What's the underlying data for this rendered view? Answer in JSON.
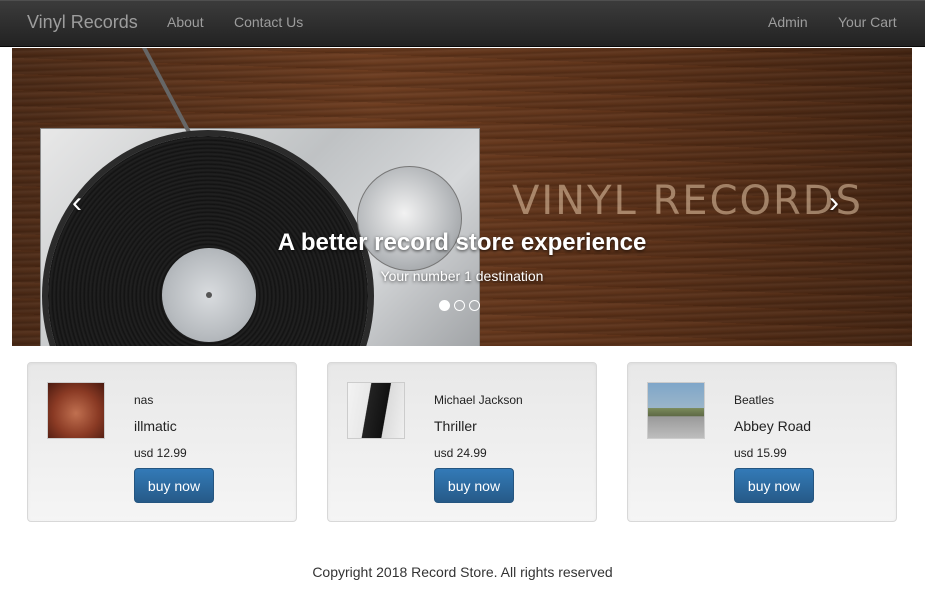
{
  "navbar": {
    "brand": "Vinyl Records",
    "links": [
      "About",
      "Contact Us"
    ],
    "right_links": [
      "Admin",
      "Your Cart"
    ]
  },
  "carousel": {
    "wordmark": "VINYL RECORDS",
    "title": "A better record store experience",
    "subtitle": "Your number 1 destination",
    "prev": "‹",
    "next": "›",
    "slide_count": 3,
    "active_slide": 1
  },
  "products": [
    {
      "artist": "nas",
      "album": "illmatic",
      "price": "usd 12.99",
      "button": "buy now",
      "cover": "illmatic-cover"
    },
    {
      "artist": "Michael Jackson",
      "album": "Thriller",
      "price": "usd 24.99",
      "button": "buy now",
      "cover": "thriller-cover"
    },
    {
      "artist": "Beatles",
      "album": "Abbey Road",
      "price": "usd 15.99",
      "button": "buy now",
      "cover": "abbey-road-cover"
    }
  ],
  "footer": {
    "text": "Copyright 2018 Record Store. All rights reserved"
  },
  "colors": {
    "navbar": "#222222",
    "nav_text": "#9d9d9d",
    "button": "#337ab7",
    "card_bg": "#f0f0f0"
  }
}
